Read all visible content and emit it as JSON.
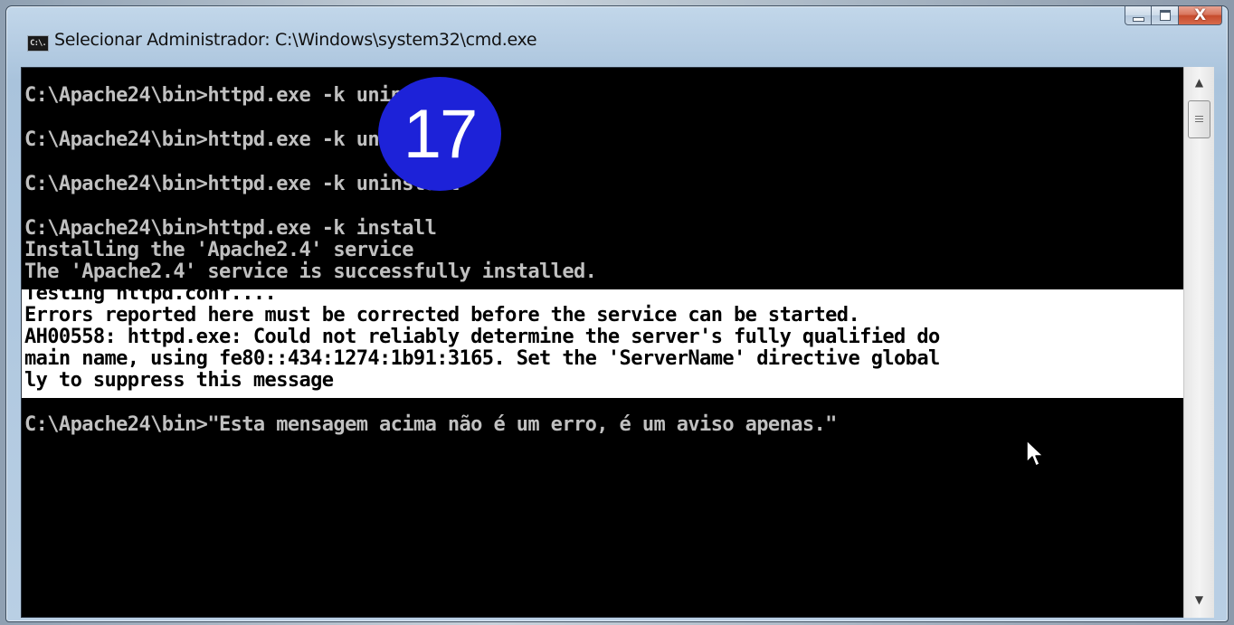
{
  "window": {
    "title": "Selecionar Administrador: C:\\Windows\\system32\\cmd.exe",
    "icon": "cmd-icon",
    "icon_text": "C:\\."
  },
  "caption_buttons": {
    "minimize_icon": "minimize-icon",
    "maximize_icon": "maximize-icon",
    "close_icon": "close-icon",
    "close_glyph": "X"
  },
  "console": {
    "background": "#000000",
    "text_color": "#c0c0c0",
    "selection_color": "#ffffff",
    "lines": [
      "C:\\Apache24\\bin>httpd.exe -k uninstall",
      "C:\\Apache24\\bin>httpd.exe -k uninstall",
      "C:\\Apache24\\bin>httpd.exe -k uninstall",
      "C:\\Apache24\\bin>httpd.exe -k install",
      "Installing the 'Apache2.4' service",
      "The 'Apache2.4' service is successfully installed.",
      "Testing httpd.conf....",
      "Errors reported here must be corrected before the service can be started.",
      "AH00558: httpd.exe: Could not reliably determine the server's fully qualified do",
      "main name, using fe80::434:1274:1b91:3165. Set the 'ServerName' directive global",
      "ly to suppress this message",
      "C:\\Apache24\\bin>\"Esta mensagem acima não é um erro, é um aviso apenas.\""
    ]
  },
  "scrollbar": {
    "up_icon": "scroll-up-arrow-icon",
    "down_icon": "scroll-down-arrow-icon",
    "up_glyph": "▲",
    "down_glyph": "▼"
  },
  "annotation": {
    "step_number": "17",
    "badge_color": "#1d22d8"
  },
  "cursor_icon": "mouse-pointer-icon"
}
